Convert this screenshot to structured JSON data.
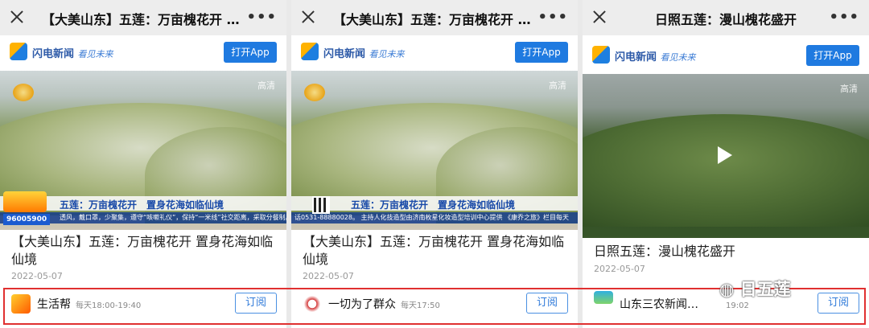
{
  "panels": [
    {
      "title": "【大美山东】五莲：万亩槐花开 置身花海如临仙境",
      "brand": "闪电新闻",
      "slogan": "看见未来",
      "open_app": "打开App",
      "video": {
        "hd_label": "高清",
        "banner_sub": "大美山东",
        "banner_title": "五莲：万亩槐花开　置身花海如临仙境",
        "scroll_text": "透风，戴口罩，少聚集，遵守“咳嗽礼仪”，保持“一米线”社交距离，采取分餐制。",
        "phone": "96005900"
      },
      "headline": "【大美山东】五莲：万亩槐花开 置身花海如临仙境",
      "date": "2022-05-07",
      "sub_name": "生活帮",
      "sub_time": "每天18:00-19:40",
      "sub_button": "订阅"
    },
    {
      "title": "【大美山东】五莲：万亩槐花开 置身花海如临仙境",
      "brand": "闪电新闻",
      "slogan": "看见未来",
      "open_app": "打开App",
      "video": {
        "hd_label": "高清",
        "banner_sub": "大美山东",
        "banner_title": "五莲：万亩槐花开　置身花海如临仙境",
        "scroll_text": "话0531-88880028。 主持人化技造型由济南枚星化妆造型培训中心提供 《康乔之旅》栏目每天",
        "phone": ""
      },
      "headline": "【大美山东】五莲：万亩槐花开 置身花海如临仙境",
      "date": "2022-05-07",
      "sub_name": "一切为了群众",
      "sub_time": "每天17:50",
      "sub_button": "订阅"
    },
    {
      "title": "日照五莲：漫山槐花盛开",
      "brand": "闪电新闻",
      "slogan": "看见未来",
      "open_app": "打开App",
      "video": {
        "hd_label": "高清"
      },
      "headline": "日照五莲：漫山槐花盛开",
      "date": "2022-05-07",
      "sub_name": "山东三农新闻…",
      "sub_time": "19:02",
      "sub_button": "订阅"
    }
  ],
  "watermark": "日五莲",
  "colors": {
    "accent": "#1f7ae0",
    "highlight_box": "#e03030"
  }
}
